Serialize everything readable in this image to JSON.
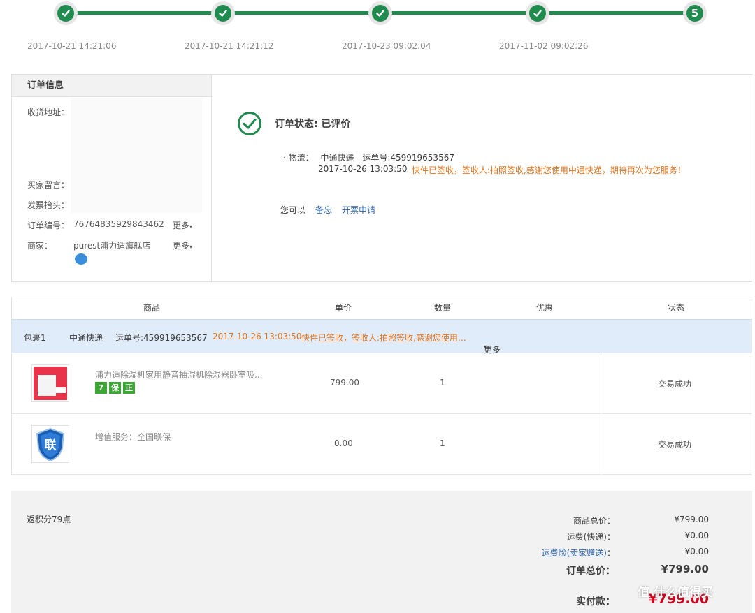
{
  "progress": {
    "steps": [
      {
        "kind": "check",
        "time": "2017-10-21 14:21:06"
      },
      {
        "kind": "check",
        "time": "2017-10-21 14:21:12"
      },
      {
        "kind": "check",
        "time": "2017-10-23 09:02:04"
      },
      {
        "kind": "check",
        "time": "2017-11-02 09:02:26"
      },
      {
        "kind": "number",
        "label": "5"
      }
    ],
    "color": "#1f8b4f"
  },
  "order_info": {
    "title": "订单信息",
    "address_label": "收货地址：",
    "message_label": "买家留言：",
    "invoice_label": "发票抬头：",
    "order_no_label": "订单编号：",
    "order_no": "76764835929843462",
    "more": "更多",
    "merchant_label": "商家：",
    "merchant": "purest浦力适旗舰店"
  },
  "status": {
    "title": "订单状态: 已评价",
    "logistics_label": "· 物流：",
    "carrier": "中通快递",
    "tracking": "运单号:459919653567",
    "time": "2017-10-26 13:03:50",
    "message": "快件已签收，签收人:拍照签收,感谢您使用中通快递，期待再次为您服务！",
    "can_label": "您可以",
    "actions": [
      "备忘",
      "开票申请"
    ]
  },
  "table": {
    "headers": [
      "商品",
      "单价",
      "数量",
      "优惠",
      "状态"
    ],
    "package": {
      "name": "包裹1",
      "carrier": "中通快递",
      "tracking": "运单号:459919653567",
      "time": "2017-10-26 13:03:50",
      "message": "快件已签收，签收人:拍照签收,感谢您使用…",
      "more": "更多"
    },
    "rows": [
      {
        "title": "浦力适除湿机家用静音抽湿机除湿器卧室吸...",
        "price": "799.00",
        "qty": "1",
        "status": "交易成功",
        "badges": [
          "7",
          "保",
          "正"
        ]
      },
      {
        "title": "增值服务：全国联保",
        "price": "0.00",
        "qty": "1",
        "status": "交易成功",
        "icon_label": "联"
      }
    ]
  },
  "summary": {
    "points": "返积分79点",
    "goods_total_label": "商品总价：",
    "goods_total": "¥799.00",
    "shipping_label": "运费(快递)：",
    "shipping": "¥0.00",
    "insurance_label": "运费险(卖家赠送)",
    "insurance_colon": "：",
    "insurance": "¥0.00",
    "order_total_label": "订单总价：",
    "order_total": "¥799.00",
    "paid_label": "实付款：",
    "paid": "¥799.00",
    "paid_color": "#d0021b"
  },
  "watermark": "值 什么值得买"
}
